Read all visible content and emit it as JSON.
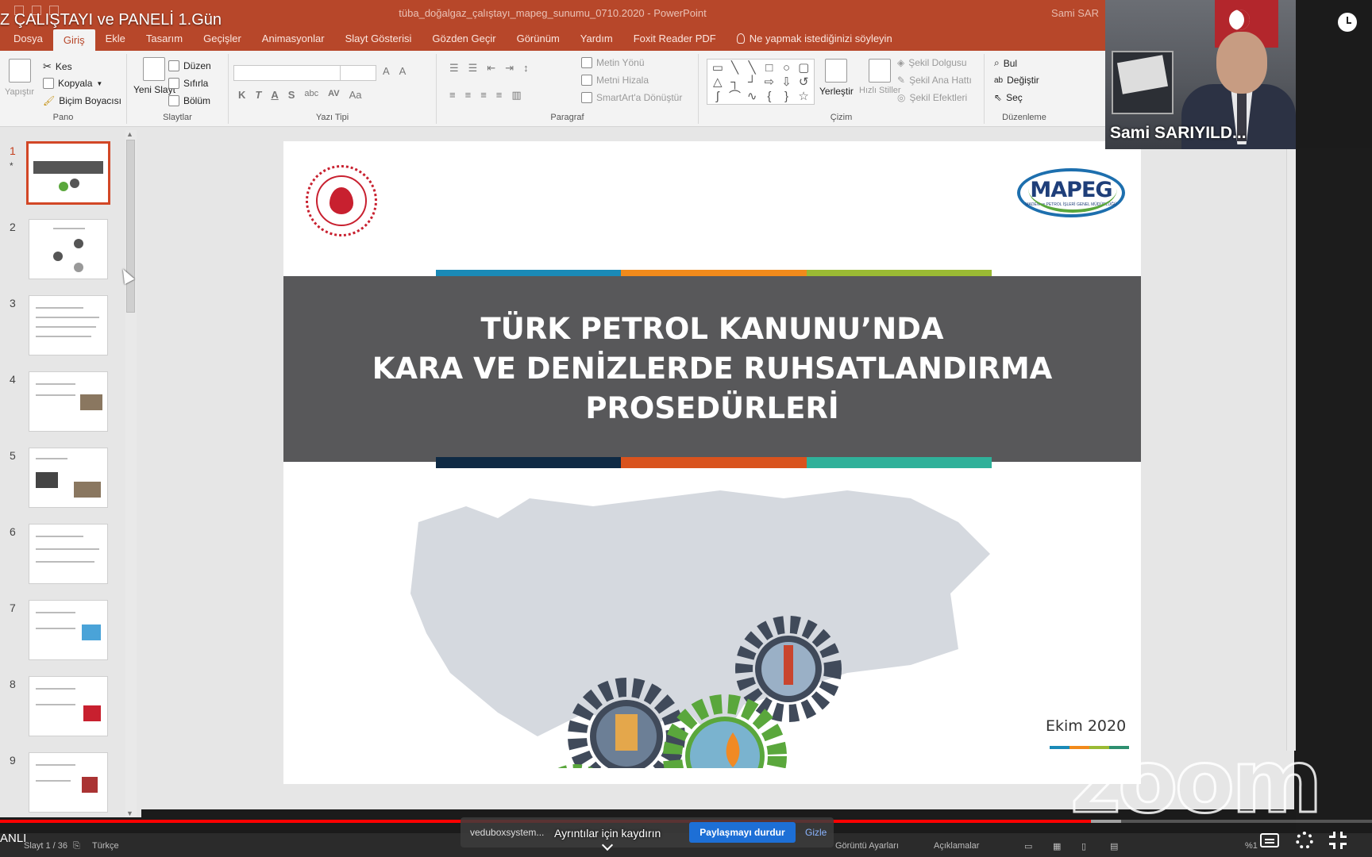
{
  "video": {
    "title": "Z ÇALIŞTAYI ve PANELİ 1.Gün",
    "left_label": "ANLI",
    "progress": 0.795,
    "buffered": 0.817,
    "scroll_hint": "Ayrıntılar için kaydırın"
  },
  "ppt": {
    "doc_title": "tüba_doğalgaz_çalıştayı_mapeg_sunumu_0710.2020  -  PowerPoint",
    "user": "Sami SAR",
    "tabs": [
      "Dosya",
      "Giriş",
      "Ekle",
      "Tasarım",
      "Geçişler",
      "Animasyonlar",
      "Slayt Gösterisi",
      "Gözden Geçir",
      "Görünüm",
      "Yardım",
      "Foxit Reader PDF"
    ],
    "active_tab": "Giriş",
    "tell_me": "Ne yapmak istediğinizi söyleyin",
    "ribbon": {
      "pano": {
        "label": "Pano",
        "paste": "Yapıştır",
        "cut": "Kes",
        "copy": "Kopyala",
        "format_painter": "Biçim Boyacısı"
      },
      "slaytlar": {
        "label": "Slaytlar",
        "new_slide": "Yeni Slayt",
        "layout": "Düzen",
        "reset": "Sıfırla",
        "section": "Bölüm"
      },
      "yazi_tipi": {
        "label": "Yazı Tipi",
        "font_size_a": "A",
        "font_size_b": "A",
        "bold": "K",
        "italic": "T",
        "underline": "A",
        "shadow": "S",
        "strike": "abc",
        "spacing": "AV",
        "case": "Aa"
      },
      "paragraf": {
        "label": "Paragraf",
        "text_dir": "Metin Yönü",
        "align_text": "Metni Hizala",
        "smartart": "SmartArt'a Dönüştür"
      },
      "cizim": {
        "label": "Çizim",
        "arrange": "Yerleştir",
        "quick_styles": "Hızlı Stiller",
        "shape_fill": "Şekil Dolgusu",
        "shape_outline": "Şekil Ana Hattı",
        "shape_effects": "Şekil Efektleri"
      },
      "duzenleme": {
        "label": "Düzenleme",
        "find": "Bul",
        "replace": "Değiştir",
        "select": "Seç"
      }
    },
    "thumbnails": [
      "1",
      "2",
      "3",
      "4",
      "5",
      "6",
      "7",
      "8",
      "9"
    ],
    "thumbnail_star": "*",
    "selected_slide": "1",
    "status": {
      "slide_counter": "Slayt 1 / 36",
      "language": "Türkçe",
      "display_settings": "Görüntü Ayarları",
      "comments": "Açıklamalar",
      "zoom": "%1"
    }
  },
  "slide": {
    "title_lines": [
      "TÜRK PETROL KANUNU’NDA",
      "KARA VE DENİZLERDE RUHSATLANDIRMA",
      "PROSEDÜRLERİ"
    ],
    "date": "Ekim 2020",
    "logo_text": "MAPEG",
    "logo_subtext": "MADEN ve PETROL İŞLERİ GENEL MÜDÜRLÜĞÜ",
    "stripe_top": [
      "#1a8ab7",
      "#f18a1b",
      "#9aba34"
    ],
    "stripe_bottom": [
      "#0f2a44",
      "#d9531e",
      "#2fb19a"
    ]
  },
  "zoom": {
    "participant": "Sami SARIYILD...",
    "share_url": "veduboxsystem...",
    "stop_share": "Paylaşmayı durdur",
    "hide": "Gizle",
    "watermark": "zoom"
  }
}
